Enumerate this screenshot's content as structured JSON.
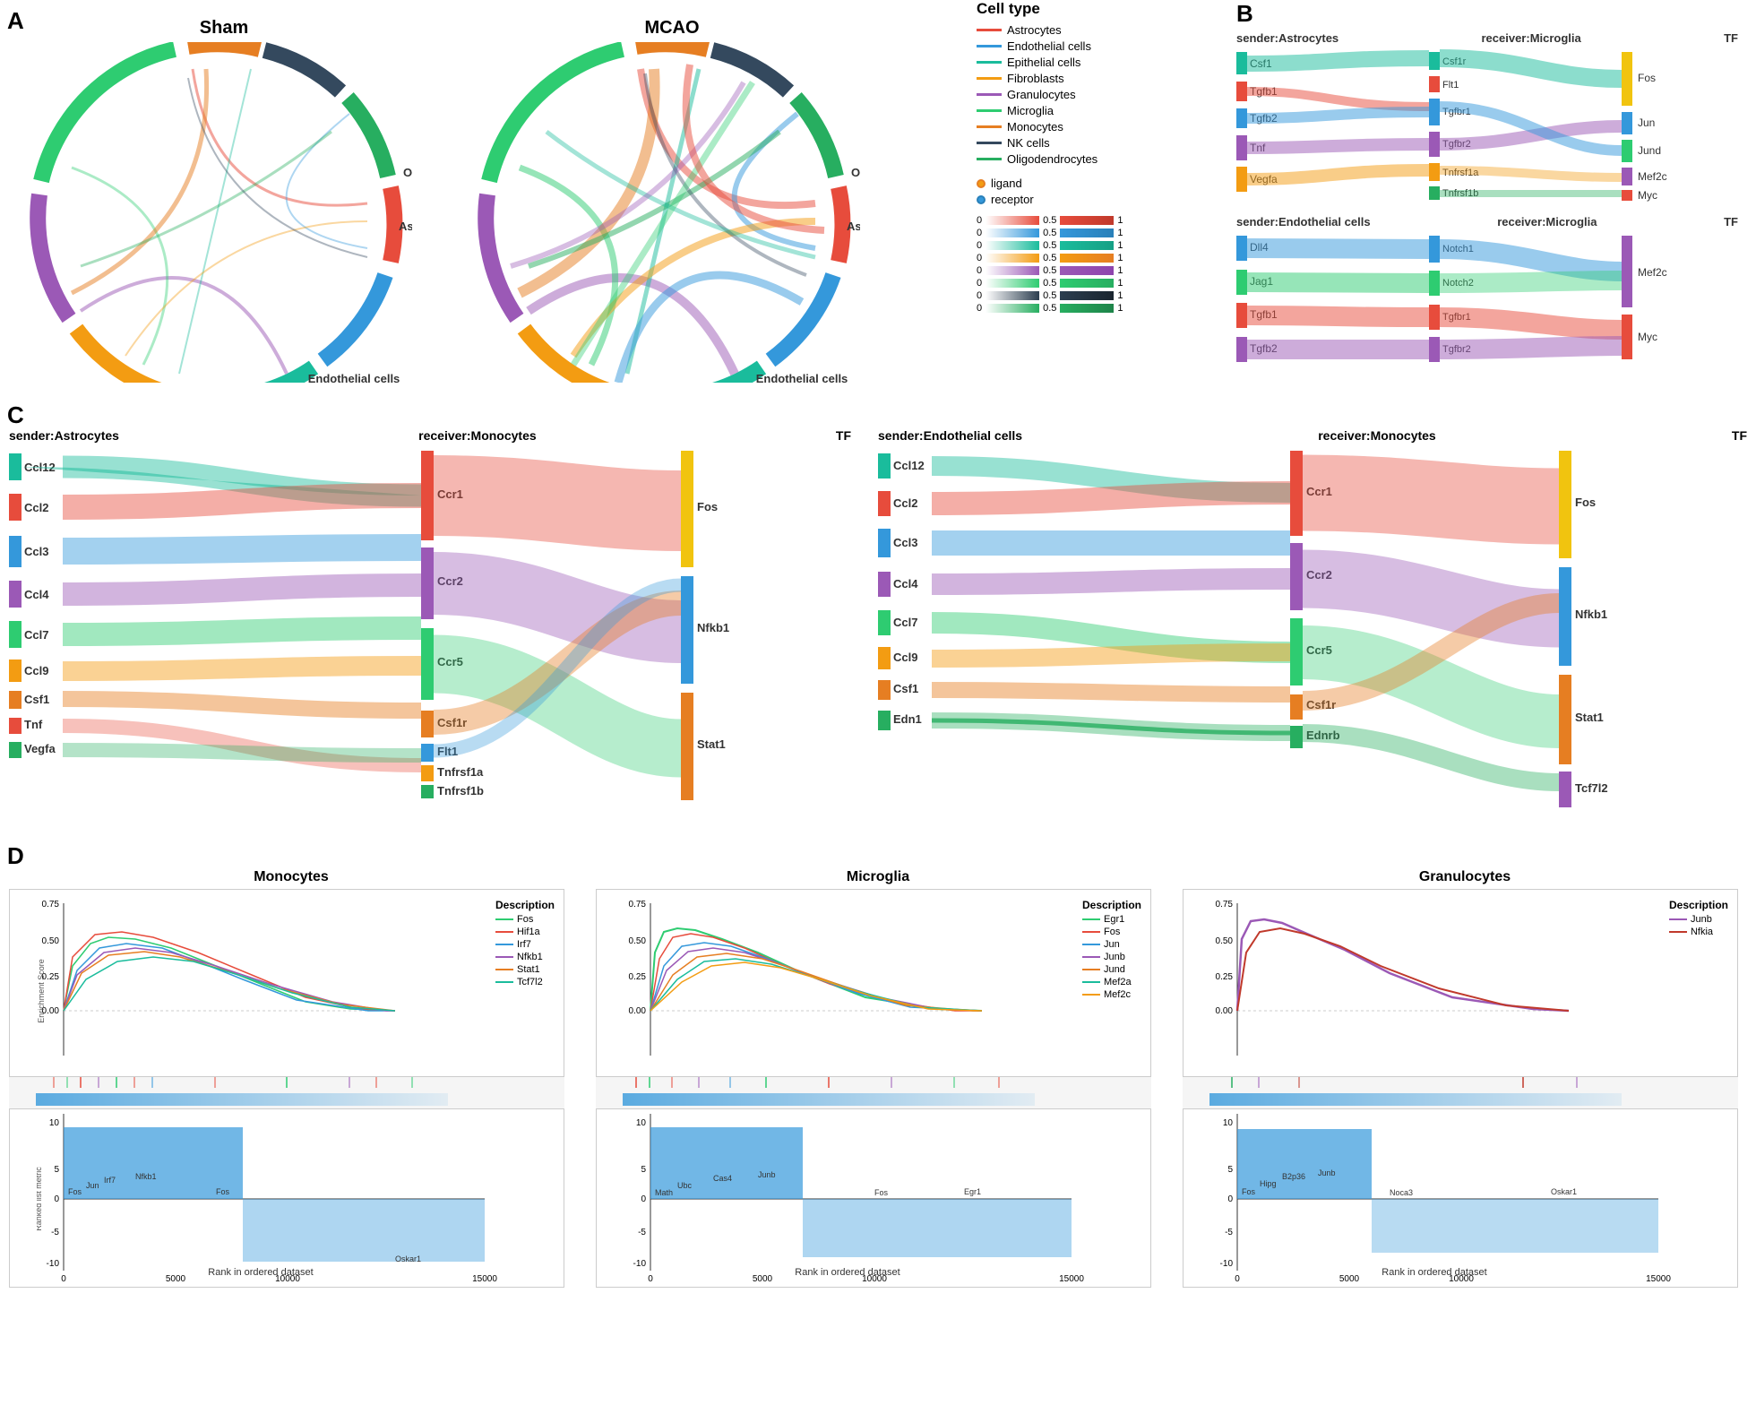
{
  "figure": {
    "panels": {
      "A": {
        "label": "A",
        "sham_title": "Sham",
        "mcao_title": "MCAO",
        "cell_types": [
          "Monocytes",
          "NK cells",
          "Oligodendrocytes",
          "Astrocytes",
          "Endothelial cells",
          "Epithelial cells",
          "Fibroblasts",
          "Granulocytes",
          "Microglia"
        ],
        "colors": {
          "Astrocytes": "#e74c3c",
          "Endothelial cells": "#3498db",
          "Epithelial cells": "#1abc9c",
          "Fibroblasts": "#f39c12",
          "Granulocytes": "#9b59b6",
          "Microglia": "#2ecc71",
          "Monocytes": "#e67e22",
          "NK cells": "#34495e",
          "Oligodendrocytes": "#27ae60"
        }
      },
      "legend": {
        "title": "Cell type",
        "items": [
          {
            "label": "Astrocytes",
            "color": "#e74c3c"
          },
          {
            "label": "Endothelial cells",
            "color": "#3498db"
          },
          {
            "label": "Epithelial cells",
            "color": "#1abc9c"
          },
          {
            "label": "Fibroblasts",
            "color": "#f39c12"
          },
          {
            "label": "Granulocytes",
            "color": "#9b59b6"
          },
          {
            "label": "Microglia",
            "color": "#2ecc71"
          },
          {
            "label": "Monocytes",
            "color": "#e67e22"
          },
          {
            "label": "NK cells",
            "color": "#34495e"
          },
          {
            "label": "Oligodendrocytes",
            "color": "#27ae60"
          }
        ],
        "ligand_label": "ligand",
        "receptor_label": "receptor",
        "gradient_labels": [
          "0",
          "0.5",
          "1"
        ]
      },
      "B": {
        "label": "B",
        "panels": [
          {
            "sender": "sender:Astrocytes",
            "receiver": "receiver:Microglia",
            "tf_label": "TF",
            "senders": [
              "Csf1",
              "Tgfb1",
              "Tgfb2",
              "Tnf",
              "Vegfa"
            ],
            "receivers": [
              "Csf1r",
              "Flt1",
              "Tgfbr1",
              "Tgfbr2",
              "Tnfrsf1a",
              "Tnfrsf1b"
            ],
            "tfs": [
              "Fos",
              "Jun",
              "Jund",
              "Mef2c",
              "Myc"
            ]
          },
          {
            "sender": "sender:Endothelial cells",
            "receiver": "receiver:Microglia",
            "tf_label": "TF",
            "senders": [
              "Dll4",
              "Jag1",
              "Tgfb1",
              "Tgfb2"
            ],
            "receivers": [
              "Notch1",
              "Notch2",
              "Tgfbr1",
              "Tgfbr2"
            ],
            "tfs": [
              "Mef2c",
              "Myc"
            ]
          }
        ]
      },
      "C": {
        "label": "C",
        "panels": [
          {
            "sender": "sender:Astrocytes",
            "receiver": "receiver:Monocytes",
            "tf_label": "TF",
            "senders": [
              "Ccl12",
              "Ccl2",
              "Ccl3",
              "Ccl4",
              "Ccl7",
              "Ccl9",
              "Csf1",
              "Tnf",
              "Vegfa"
            ],
            "receivers": [
              "Ccr1",
              "Ccr2",
              "Ccr5",
              "Csf1r",
              "Flt1",
              "Tnfrsf1a",
              "Tnfrsf1b"
            ],
            "tfs": [
              "Fos",
              "Nfkb1",
              "Stat1"
            ]
          },
          {
            "sender": "sender:Endothelial cells",
            "receiver": "receiver:Monocytes",
            "tf_label": "TF",
            "senders": [
              "Ccl12",
              "Ccl2",
              "Ccl3",
              "Ccl4",
              "Ccl7",
              "Ccl9",
              "Csf1",
              "Edn1"
            ],
            "receivers": [
              "Ccr1",
              "Ccr2",
              "Ccr5",
              "Csf1r",
              "Ednrb"
            ],
            "tfs": [
              "Fos",
              "Nfkb1",
              "Stat1",
              "Tcf7l2"
            ]
          }
        ]
      },
      "D": {
        "label": "D",
        "panels": [
          {
            "title": "Monocytes",
            "description_label": "Description",
            "items": [
              "Fos",
              "Hif1a",
              "Irf7",
              "Nfkb1",
              "Stat1",
              "Tcf7l2"
            ],
            "colors": [
              "#2ecc71",
              "#e74c3c",
              "#3498db",
              "#9b59b6",
              "#e67e22",
              "#1abc9c"
            ],
            "x_label": "Rank in ordered dataset",
            "y_label": "Enrichment Score",
            "x_max": 15000
          },
          {
            "title": "Microglia",
            "description_label": "Description",
            "items": [
              "Egr1",
              "Fos",
              "Jun",
              "Junb",
              "Jund",
              "Mef2a",
              "Mef2c"
            ],
            "colors": [
              "#2ecc71",
              "#e74c3c",
              "#3498db",
              "#9b59b6",
              "#e67e22",
              "#1abc9c",
              "#f39c12"
            ],
            "x_label": "Rank in ordered dataset",
            "y_label": "Enrichment Score",
            "x_max": 15000
          },
          {
            "title": "Granulocytes",
            "description_label": "Description",
            "items": [
              "Junb",
              "Nfkia"
            ],
            "colors": [
              "#9b59b6",
              "#c0392b"
            ],
            "x_label": "Rank in ordered dataset",
            "y_label": "Enrichment Score",
            "x_max": 15000
          }
        ]
      }
    }
  }
}
